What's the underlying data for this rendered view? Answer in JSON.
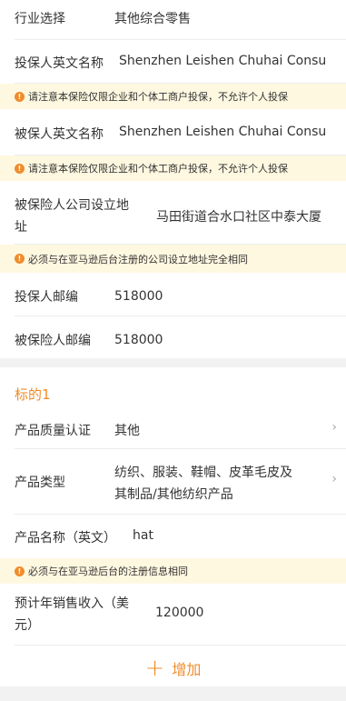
{
  "industry": {
    "label": "行业选择",
    "value": "其他综合零售"
  },
  "policyholder_name_en": {
    "label": "投保人英文名称",
    "value": "Shenzhen Leishen Chuhai Consu"
  },
  "notice_individual": "请注意本保险仅限企业和个体工商户投保，不允许个人投保",
  "insured_name_en": {
    "label": "被保人英文名称",
    "value": "Shenzhen Leishen Chuhai Consu"
  },
  "insured_address": {
    "label_line1": "被保险人公司设立地",
    "label_line2": "址",
    "value": "马田街道合水口社区中泰大厦"
  },
  "notice_address": "必须与在亚马逊后台注册的公司设立地址完全相同",
  "policyholder_zip": {
    "label": "投保人邮编",
    "value": "518000"
  },
  "insured_zip": {
    "label": "被保险人邮编",
    "value": "518000"
  },
  "subject": {
    "title": "标的1",
    "quality_cert": {
      "label": "产品质量认证",
      "value": "其他"
    },
    "product_type": {
      "label": "产品类型",
      "value_line1": "纺织、服装、鞋帽、皮革毛皮及",
      "value_line2": "其制品/其他纺织产品"
    },
    "product_name": {
      "label": "产品名称（英文）",
      "value": "hat"
    },
    "notice_registration": "必须与在亚马逊后台的注册信息相同",
    "annual_sales": {
      "label_line1": "预计年销售收入（美",
      "label_line2": "元）",
      "value": "120000"
    }
  },
  "add_button": {
    "icon": "plus-icon",
    "label": "增加"
  },
  "colors": {
    "accent": "#f08c2b",
    "notice_bg": "#fff8e1"
  }
}
